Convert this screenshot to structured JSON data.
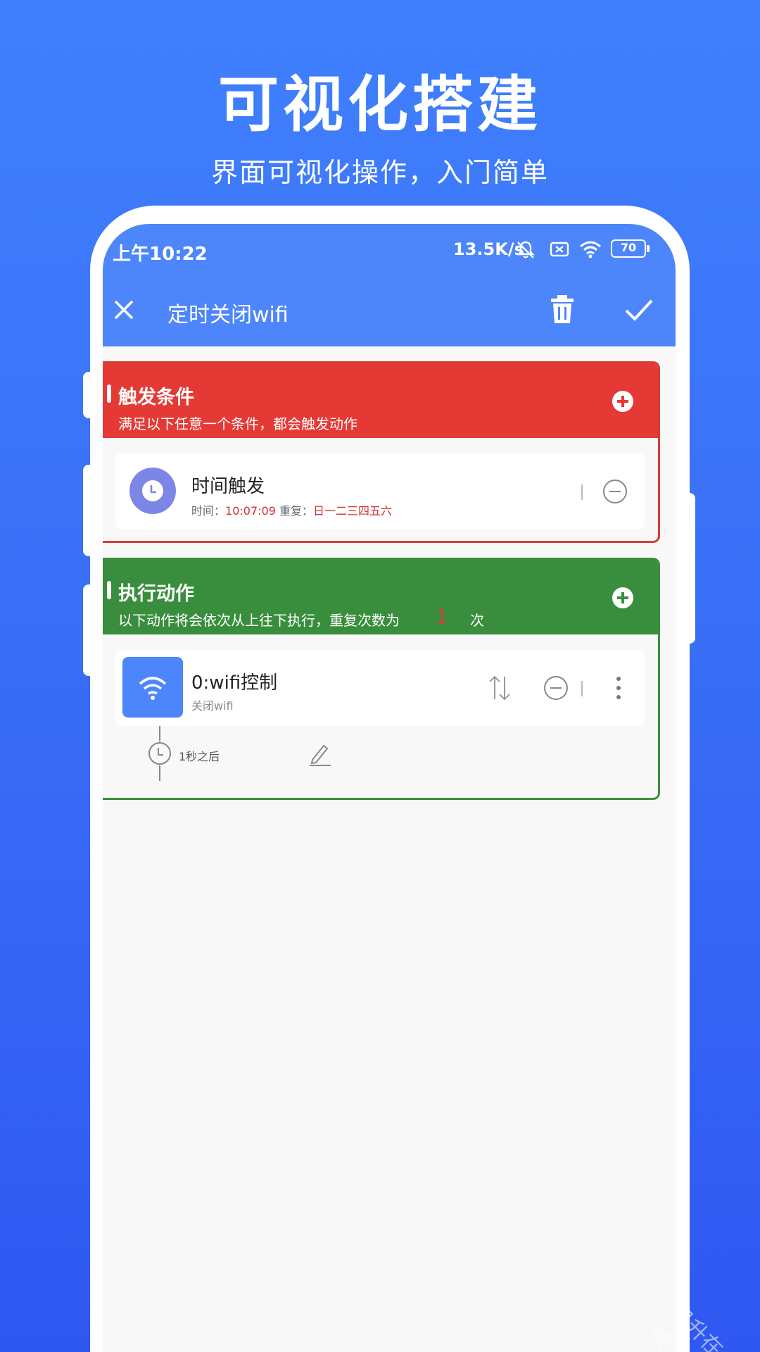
{
  "hero": {
    "title": "可视化搭建",
    "subtitle": "界面可视化操作，入门简单"
  },
  "status_bar": {
    "time": "上午10:22",
    "net_speed": "13.5K/s",
    "battery": "70",
    "icons": [
      "mute-bell-icon",
      "sim-off-icon",
      "wifi-icon",
      "battery-icon"
    ]
  },
  "app_bar": {
    "title": "定时关闭wifi",
    "icons": [
      "close-icon",
      "trash-icon",
      "check-icon"
    ]
  },
  "trigger_section": {
    "title": "触发条件",
    "description": "满足以下任意一个条件，都会触发动作",
    "color": "#e53935",
    "items": [
      {
        "title": "时间触发",
        "time_label": "时间：",
        "time_value": "10:07:09",
        "repeat_label": " 重复：",
        "repeat_value": "日一二三四五六"
      }
    ]
  },
  "action_section": {
    "title": "执行动作",
    "description": "以下动作将会依次从上往下执行，重复次数为",
    "repeat_count": "1",
    "description_tail": "次",
    "color": "#388e3c",
    "items": [
      {
        "title": "0:wifi控制",
        "subtitle": "关闭wifi",
        "delay": "1秒之后"
      }
    ]
  },
  "colors": {
    "primary": "#4d86fa",
    "trigger": "#e53935",
    "action": "#388e3c",
    "clock_circle": "#7b86e6"
  },
  "watermark": "日升在线"
}
